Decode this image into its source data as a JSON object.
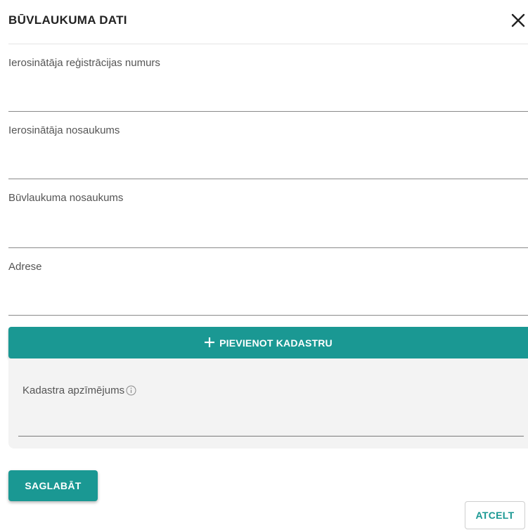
{
  "dialog": {
    "title": "BŪVLAUKUMA DATI",
    "close_icon": "close-icon"
  },
  "form": {
    "fields": [
      {
        "label": "Ierosinātāja reģistrācijas numurs",
        "value": "",
        "placeholder": ""
      },
      {
        "label": "Ierosinātāja nosaukums",
        "value": "",
        "placeholder": ""
      },
      {
        "label": "Būvlaukuma nosaukums",
        "value": "",
        "placeholder": ""
      },
      {
        "label": "Adrese",
        "value": "",
        "placeholder": ""
      }
    ]
  },
  "cadastre": {
    "add_icon": "plus-icon",
    "add_label": "PIEVIENOT KADASTRU",
    "field_label": "Kadastra apzīmējums",
    "info_icon": "info-icon",
    "value": ""
  },
  "actions": {
    "save_label": "SAGLABĀT",
    "cancel_label": "ATCELT"
  },
  "colors": {
    "accent": "#1a9893",
    "panel_bg": "#f3f3f3",
    "divider": "#e4e4e4"
  }
}
